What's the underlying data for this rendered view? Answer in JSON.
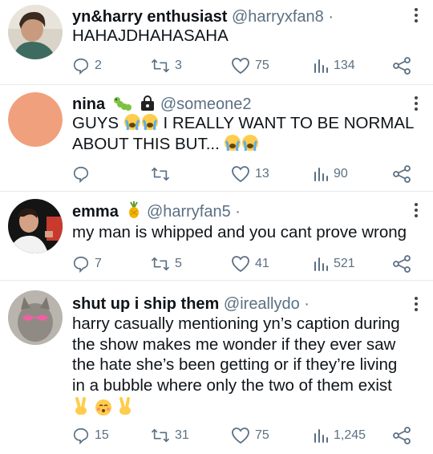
{
  "tweets": [
    {
      "name": "yn&harry enthusiast",
      "handle": "@harryxfan8",
      "separator": "·",
      "text": "HAHAJDHAHASAHA",
      "replies": "2",
      "retweets": "3",
      "likes": "75",
      "views": "134"
    },
    {
      "name": "nina",
      "name_icons": [
        "caterpillar-icon",
        "lock-bag-icon"
      ],
      "handle": "@someone2",
      "text_line1": "GUYS",
      "text_line1b": "I REALLY WANT TO BE NORMAL",
      "text_line2": "ABOUT THIS BUT...",
      "replies": "",
      "retweets": "",
      "likes": "13",
      "views": "90"
    },
    {
      "name": "emma",
      "name_icons": [
        "pineapple-icon"
      ],
      "handle": "@harryfan5",
      "separator": "·",
      "text": "my man is whipped and you cant prove wrong",
      "replies": "7",
      "retweets": "5",
      "likes": "41",
      "views": "521"
    },
    {
      "name": "shut up i ship them",
      "handle": "@ireallydo",
      "separator": "·",
      "text_lines": [
        "harry casually mentioning yn’s caption during",
        "the show makes me wonder if they ever saw",
        "the hate she’s been getting or if they’re living",
        "in a bubble where only the two of them exist"
      ],
      "replies": "15",
      "retweets": "31",
      "likes": "75",
      "views": "1,245"
    }
  ],
  "colors": {
    "text": "#0f1419",
    "muted": "#5b7083",
    "divider": "#e6e9eb",
    "avatar_peach": "#f0a07c"
  }
}
